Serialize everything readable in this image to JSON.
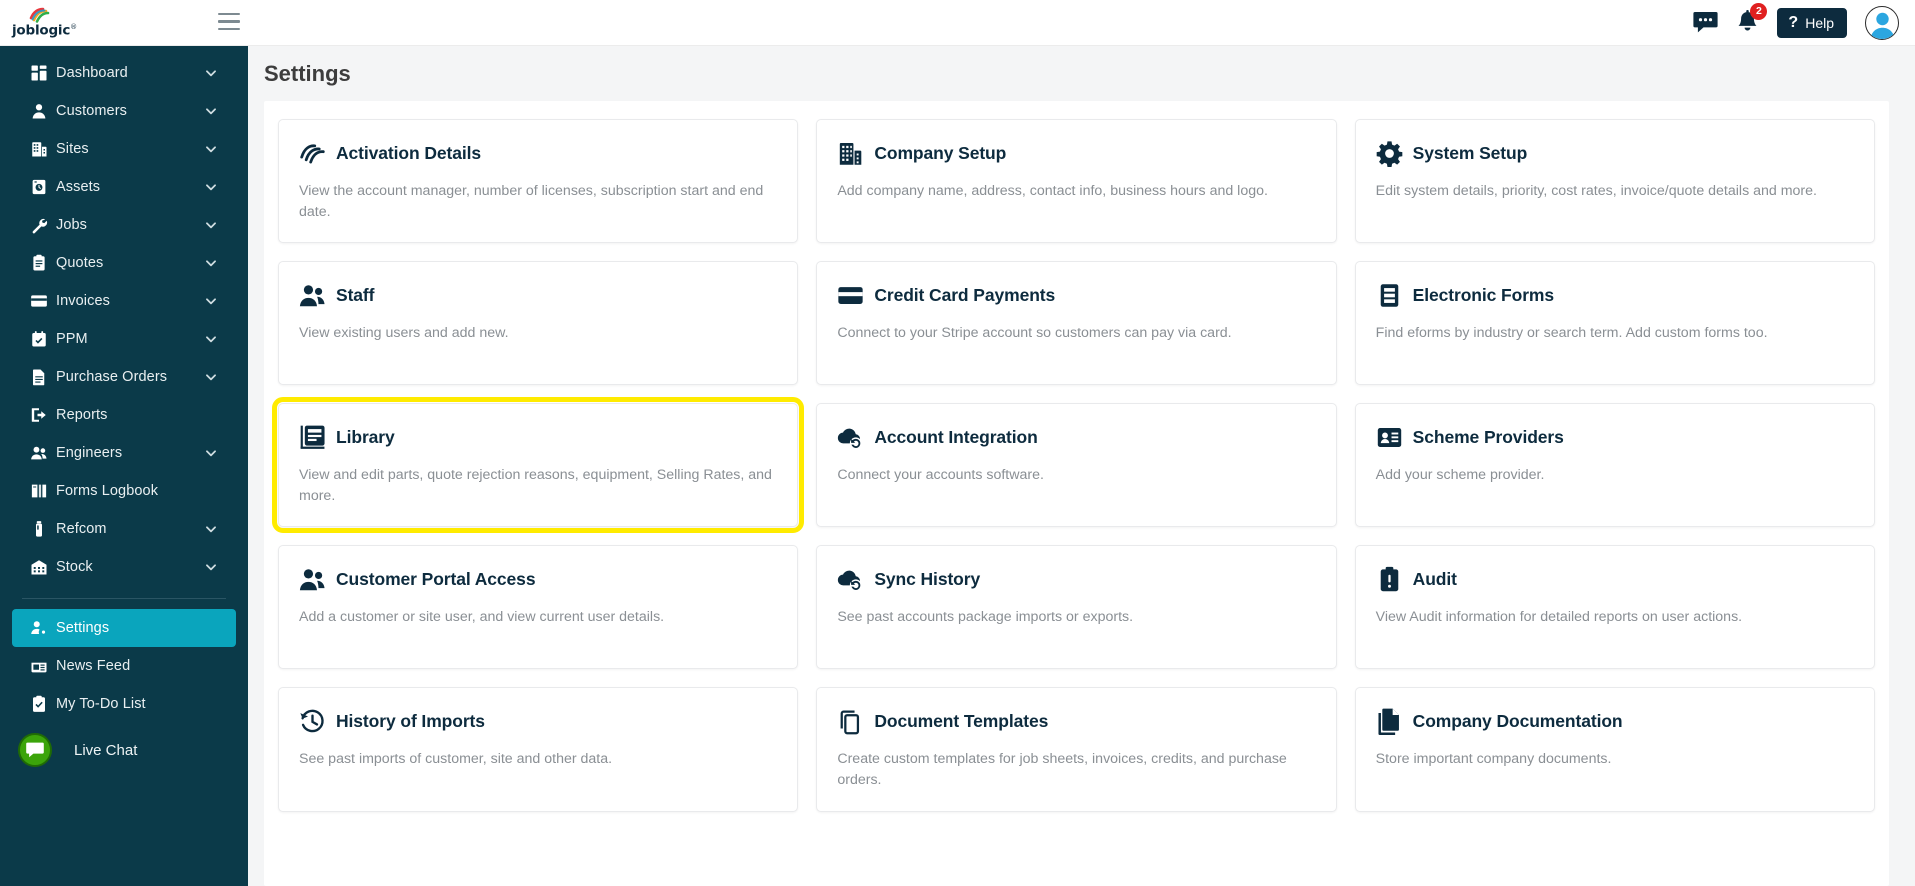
{
  "topbar": {
    "logo_text": "joblogic",
    "logo_sup": "®",
    "menu_icon": "hamburger-icon",
    "messages_icon": "chat-bubble-icon",
    "notifications_icon": "bell-icon",
    "notifications_count": "2",
    "help_label": "Help",
    "help_icon": "question-mark-icon",
    "avatar_icon": "user-avatar-icon"
  },
  "sidebar": {
    "items": [
      {
        "label": "Dashboard",
        "icon": "dashboard-grid-icon",
        "chevron": true,
        "active": false
      },
      {
        "label": "Customers",
        "icon": "person-icon",
        "chevron": true,
        "active": false
      },
      {
        "label": "Sites",
        "icon": "building-icon",
        "chevron": true,
        "active": false
      },
      {
        "label": "Assets",
        "icon": "asset-box-icon",
        "chevron": true,
        "active": false
      },
      {
        "label": "Jobs",
        "icon": "wrench-icon",
        "chevron": true,
        "active": false
      },
      {
        "label": "Quotes",
        "icon": "clipboard-icon",
        "chevron": true,
        "active": false
      },
      {
        "label": "Invoices",
        "icon": "invoice-card-icon",
        "chevron": true,
        "active": false
      },
      {
        "label": "PPM",
        "icon": "calendar-check-icon",
        "chevron": true,
        "active": false
      },
      {
        "label": "Purchase Orders",
        "icon": "document-icon",
        "chevron": true,
        "active": false
      },
      {
        "label": "Reports",
        "icon": "export-arrow-icon",
        "chevron": false,
        "active": false
      },
      {
        "label": "Engineers",
        "icon": "people-icon",
        "chevron": true,
        "active": false
      },
      {
        "label": "Forms Logbook",
        "icon": "open-book-icon",
        "chevron": false,
        "active": false
      },
      {
        "label": "Refcom",
        "icon": "cylinder-icon",
        "chevron": true,
        "active": false
      },
      {
        "label": "Stock",
        "icon": "warehouse-icon",
        "chevron": true,
        "active": false
      }
    ],
    "items2": [
      {
        "label": "Settings",
        "icon": "user-gear-icon",
        "chevron": false,
        "active": true
      },
      {
        "label": "News Feed",
        "icon": "news-icon",
        "chevron": false,
        "active": false
      },
      {
        "label": "My To-Do List",
        "icon": "clipboard-check-icon",
        "chevron": false,
        "active": false
      }
    ],
    "live_chat": {
      "label": "Live Chat",
      "icon": "chat-icon"
    },
    "accent_color": "#0aa5bd",
    "background_color": "#0b3a49"
  },
  "main": {
    "page_title": "Settings",
    "highlight_color": "#ffeb00",
    "cards": [
      {
        "title": "Activation Details",
        "desc": "View the account manager, number of licenses, subscription start and end date.",
        "icon": "activation-swoosh-icon",
        "highlight": false
      },
      {
        "title": "Company Setup",
        "desc": "Add company name, address, contact info, business hours and logo.",
        "icon": "building-icon",
        "highlight": false
      },
      {
        "title": "System Setup",
        "desc": "Edit system details, priority, cost rates, invoice/quote details and more.",
        "icon": "gear-icon",
        "highlight": false
      },
      {
        "title": "Staff",
        "desc": "View existing users and add new.",
        "icon": "people-icon",
        "highlight": false
      },
      {
        "title": "Credit Card Payments",
        "desc": "Connect to your Stripe account so customers can pay via card.",
        "icon": "credit-card-icon",
        "highlight": false
      },
      {
        "title": "Electronic Forms",
        "desc": "Find eforms by industry or search term. Add custom forms too.",
        "icon": "form-lines-icon",
        "highlight": false
      },
      {
        "title": "Library",
        "desc": "View and edit parts, quote rejection reasons, equipment, Selling Rates, and more.",
        "icon": "library-book-icon",
        "highlight": true
      },
      {
        "title": "Account Integration",
        "desc": "Connect your accounts software.",
        "icon": "cloud-sync-icon",
        "highlight": false
      },
      {
        "title": "Scheme Providers",
        "desc": "Add your scheme provider.",
        "icon": "id-card-icon",
        "highlight": false
      },
      {
        "title": "Customer Portal Access",
        "desc": "Add a customer or site user, and view current user details.",
        "icon": "people-icon",
        "highlight": false
      },
      {
        "title": "Sync History",
        "desc": "See past accounts package imports or exports.",
        "icon": "cloud-sync-icon",
        "highlight": false
      },
      {
        "title": "Audit",
        "desc": "View Audit information for detailed reports on user actions.",
        "icon": "clipboard-alert-icon",
        "highlight": false
      },
      {
        "title": "History of Imports",
        "desc": "See past imports of customer, site and other data.",
        "icon": "clock-history-icon",
        "highlight": false
      },
      {
        "title": "Document Templates",
        "desc": "Create custom templates for job sheets, invoices, credits, and purchase orders.",
        "icon": "copy-documents-icon",
        "highlight": false
      },
      {
        "title": "Company Documentation",
        "desc": "Store important company documents.",
        "icon": "document-stack-icon",
        "highlight": false
      }
    ]
  }
}
